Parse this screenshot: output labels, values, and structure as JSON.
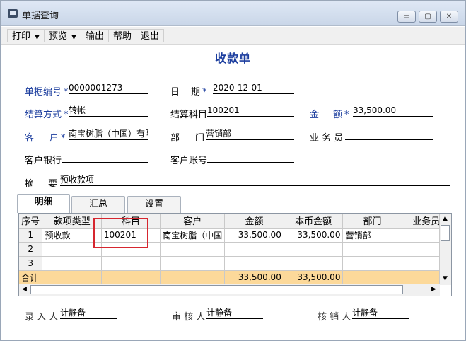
{
  "window": {
    "title": "单据查询",
    "min_label": "▭",
    "max_label": "▢",
    "close_label": "✕"
  },
  "menu": [
    {
      "label": "打印",
      "has_arrow": true
    },
    {
      "label": "预览",
      "has_arrow": true
    },
    {
      "label": "输出"
    },
    {
      "label": "帮助"
    },
    {
      "label": "退出"
    }
  ],
  "form": {
    "title": "收款单",
    "doc_no_label": "单据编号",
    "doc_no": "0000001273",
    "date_label_1": "日",
    "date_label_2": "期",
    "date": "2020-12-01",
    "settle_method_label": "结算方式",
    "settle_method": "转帐",
    "settle_subject_label": "结算科目",
    "settle_subject": "100201",
    "amount_label_1": "金",
    "amount_label_2": "额",
    "amount": "33,500.00",
    "customer_label_1": "客",
    "customer_label_2": "户",
    "customer": "南宝树脂（中国）有限",
    "dept_label_1": "部",
    "dept_label_2": "门",
    "dept": "营销部",
    "salesman_label": "业 务 员",
    "salesman": "",
    "bank_label": "客户银行",
    "bank": "",
    "account_label": "客户账号",
    "account": "",
    "summary_label_1": "摘",
    "summary_label_2": "要",
    "summary": "预收款项",
    "required_mark": "*"
  },
  "tabs": [
    "明细",
    "汇总",
    "设置"
  ],
  "grid": {
    "columns": [
      "序号",
      "款项类型",
      "科目",
      "客户",
      "金额",
      "本币金额",
      "部门",
      "业务员"
    ],
    "rows": [
      [
        "1",
        "预收款",
        "100201",
        "南宝树脂（中国",
        "33,500.00",
        "33,500.00",
        "营销部",
        ""
      ],
      [
        "2",
        "",
        "",
        "",
        "",
        "",
        "",
        ""
      ],
      [
        "3",
        "",
        "",
        "",
        "",
        "",
        "",
        ""
      ]
    ],
    "total": [
      "合计",
      "",
      "",
      "",
      "33,500.00",
      "33,500.00",
      "",
      ""
    ]
  },
  "footer": {
    "entry_label": "录 入 人",
    "entry": "计静备",
    "review_label": "审 核 人",
    "review": "计静备",
    "verify_label": "核 销 人",
    "verify": "计静备"
  },
  "colors": {
    "title_blue": "#1b3d9e",
    "total_row": "#fcd99a",
    "highlight": "#d6262f"
  }
}
